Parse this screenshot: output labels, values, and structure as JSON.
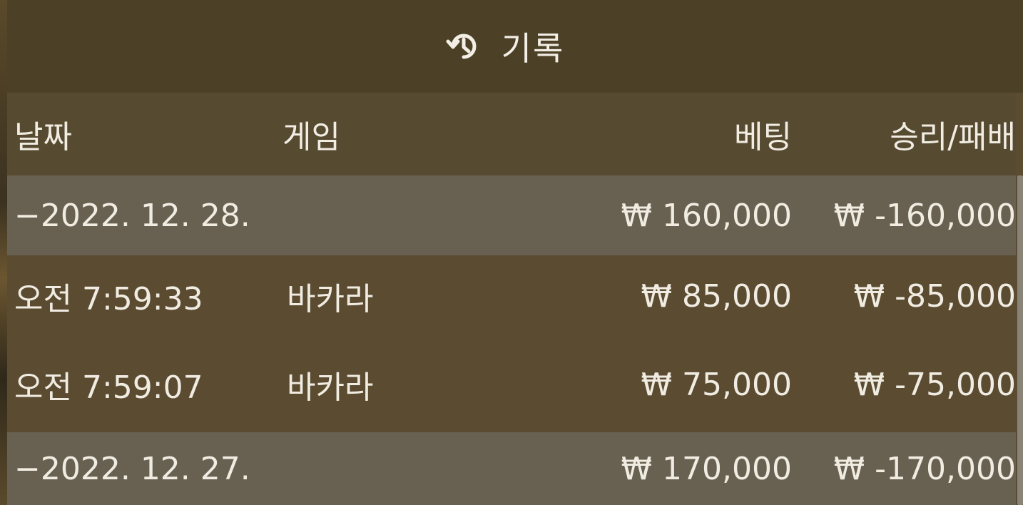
{
  "header": {
    "icon": "history-icon",
    "title": "기록"
  },
  "table": {
    "columns": {
      "date": "날짜",
      "game": "게임",
      "bet": "베팅",
      "result": "승리/패배"
    },
    "rows": [
      {
        "type": "group",
        "date": "−2022. 12. 28.",
        "game": "",
        "bet": "₩ 160,000",
        "result": "₩ -160,000"
      },
      {
        "type": "detail",
        "date": "오전 7:59:33",
        "game": "바카라",
        "bet": "₩ 85,000",
        "result": "₩ -85,000"
      },
      {
        "type": "detail",
        "date": "오전 7:59:07",
        "game": "바카라",
        "bet": "₩ 75,000",
        "result": "₩ -75,000"
      },
      {
        "type": "group",
        "date": "−2022. 12. 27.",
        "game": "",
        "bet": "₩ 170,000",
        "result": "₩ -170,000"
      }
    ]
  },
  "colors": {
    "header_bg": "#4c4127",
    "group_row_bg": "#686050",
    "detail_row_bg": "#5a4b31",
    "text": "#f1ece2"
  }
}
